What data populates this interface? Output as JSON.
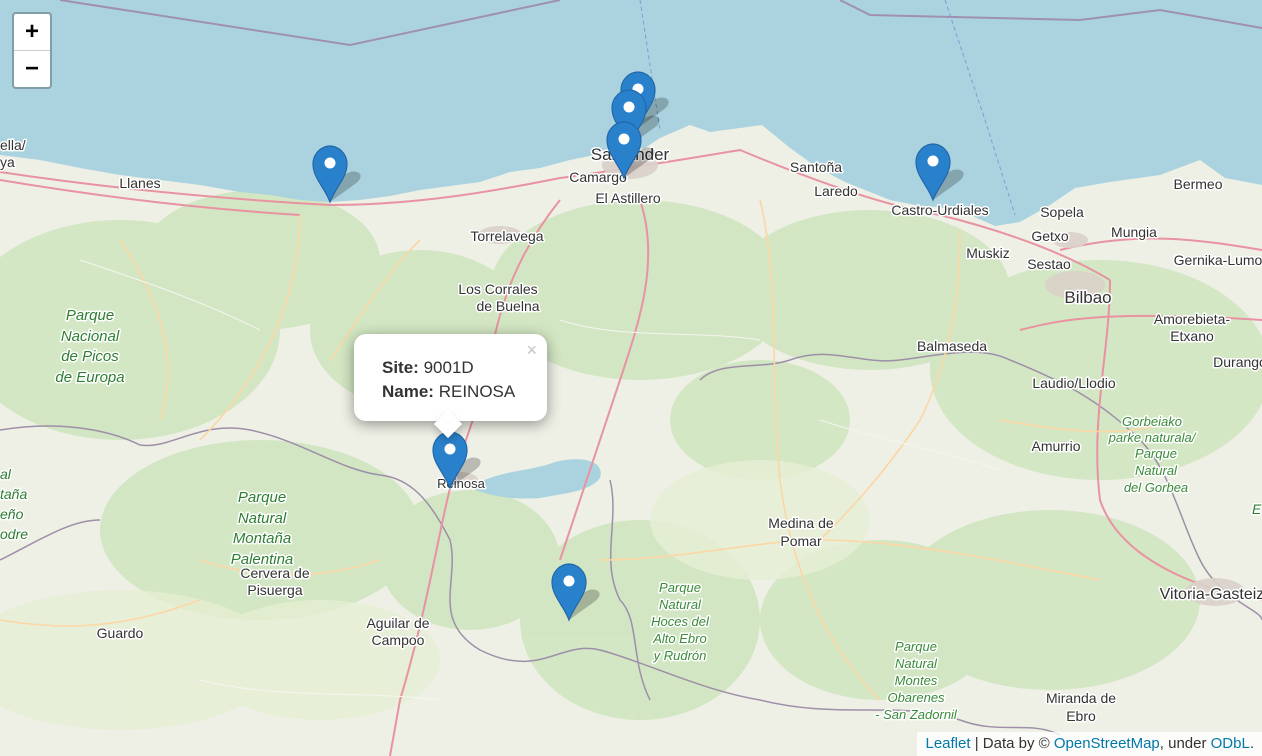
{
  "zoom": {
    "in_label": "+",
    "out_label": "−"
  },
  "popup": {
    "site_label": "Site:",
    "site_value": "9001D",
    "name_label": "Name:",
    "name_value": "REINOSA",
    "close_label": "×"
  },
  "attribution": {
    "leaflet": "Leaflet",
    "sep1": " | Data by © ",
    "osm": "OpenStreetMap",
    "sep2": ", under ",
    "odbl": "ODbL",
    "end": "."
  },
  "markers": [
    {
      "id": "marker-1",
      "color": "#2a81cb"
    },
    {
      "id": "marker-2",
      "color": "#2a81cb"
    },
    {
      "id": "marker-3",
      "color": "#2a81cb"
    },
    {
      "id": "marker-4",
      "color": "#2a81cb"
    },
    {
      "id": "marker-5",
      "color": "#2a81cb"
    },
    {
      "id": "marker-6",
      "color": "#2a81cb"
    },
    {
      "id": "marker-7",
      "color": "#2a81cb"
    }
  ],
  "places": {
    "llanes": "Llanes",
    "santander": "Santander",
    "camargo": "Camargo",
    "el_astillero": "El Astillero",
    "santona": "Santoña",
    "laredo": "Laredo",
    "castro": "Castro-Urdiales",
    "bermeo": "Bermeo",
    "sopela": "Sopela",
    "getxo": "Getxo",
    "mungia": "Mungia",
    "gernika": "Gernika-Lumo",
    "muskiz": "Muskiz",
    "sestao": "Sestao",
    "bilbao": "Bilbao",
    "torrelavega": "Torrelavega",
    "los_corrales_1": "Los Corrales",
    "los_corrales_2": "de Buelna",
    "amorebieta_1": "Amorebieta-",
    "amorebieta_2": "Etxano",
    "balmaseda": "Balmaseda",
    "durango": "Durango",
    "laudio": "Laudio/Llodio",
    "amurrio": "Amurrio",
    "reinosa": "Reinosa",
    "medina_1": "Medina de",
    "medina_2": "Pomar",
    "cervera_1": "Cervera de",
    "cervera_2": "Pisuerga",
    "guardo": "Guardo",
    "aguilar_1": "Aguilar de",
    "aguilar_2": "Campoo",
    "vitoria": "Vitoria-Gasteiz",
    "miranda_1": "Miranda de",
    "miranda_2": "Ebro",
    "ella": "ella/",
    "ya": "ya",
    "al": "al",
    "tana": "taña",
    "eno": "eño",
    "odre": "odre",
    "ed": "E"
  },
  "parks": {
    "picos": [
      "Parque",
      "Nacional",
      "de Picos",
      "de Europa"
    ],
    "palentina": [
      "Parque",
      "Natural",
      "Montaña",
      "Palentina"
    ],
    "hoces": [
      "Parque",
      "Natural",
      "Hoces del",
      "Alto Ebro",
      "y Rudrón"
    ],
    "gorbeia": [
      "Gorbeiako",
      "parke naturala/",
      "Parque",
      "Natural",
      "del Gorbea"
    ],
    "obarenes": [
      "Parque",
      "Natural",
      "Montes",
      "Obarenes",
      "- San Zadornil"
    ]
  }
}
